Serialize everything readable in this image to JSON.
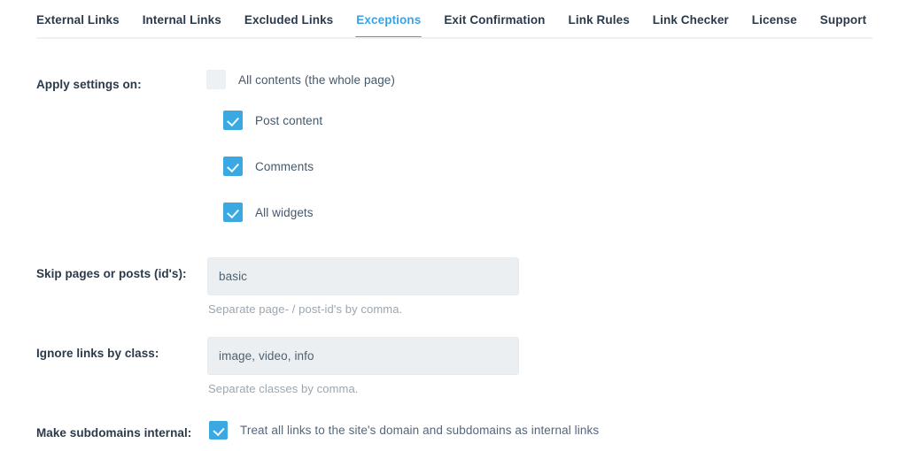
{
  "tabs": {
    "items": [
      {
        "label": "External Links",
        "active": false
      },
      {
        "label": "Internal Links",
        "active": false
      },
      {
        "label": "Excluded Links",
        "active": false
      },
      {
        "label": "Exceptions",
        "active": true
      },
      {
        "label": "Exit Confirmation",
        "active": false
      },
      {
        "label": "Link Rules",
        "active": false
      },
      {
        "label": "Link Checker",
        "active": false
      },
      {
        "label": "License",
        "active": false
      },
      {
        "label": "Support",
        "active": false
      }
    ],
    "active_color": "#3ba3e0"
  },
  "colors": {
    "accent": "#3ba8e2",
    "label": "#2b3a4a",
    "hint": "#9aa6b0",
    "field_bg": "#eceff1"
  },
  "apply_settings": {
    "label": "Apply settings on:",
    "options": [
      {
        "label": "All contents (the whole page)",
        "checked": false
      },
      {
        "label": "Post content",
        "checked": true
      },
      {
        "label": "Comments",
        "checked": true
      },
      {
        "label": "All widgets",
        "checked": true
      }
    ]
  },
  "skip_pages": {
    "label": "Skip pages or posts (id's):",
    "value": "basic",
    "placeholder": "",
    "hint": "Separate page- / post-id's by comma."
  },
  "ignore_class": {
    "label": "Ignore links by class:",
    "value": "image, video, info",
    "placeholder": "",
    "hint": "Separate classes by comma."
  },
  "subdomains": {
    "label": "Make subdomains internal:",
    "option": {
      "label": "Treat all links to the site's domain and subdomains as internal links",
      "checked": true
    }
  }
}
